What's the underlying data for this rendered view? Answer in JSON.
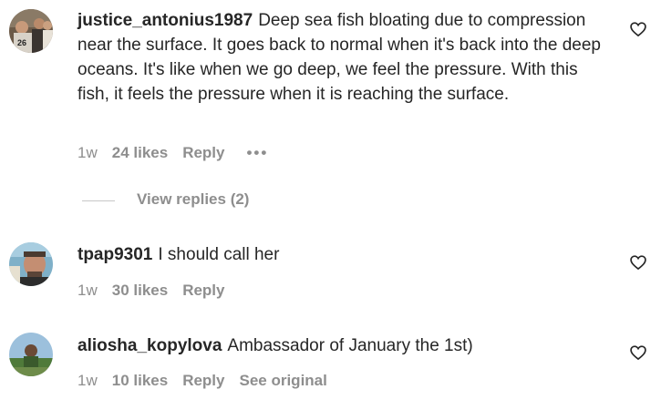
{
  "comments": [
    {
      "username": "justice_antonius1987",
      "text": "Deep sea fish bloating due to compression near the surface. It goes back to normal when it's back into the deep oceans. It's like when we go deep, we feel the pressure. With this fish, it feels the pressure when it is reaching the surface.",
      "time": "1w",
      "likes": "24 likes",
      "reply": "Reply",
      "more": "•••",
      "view_replies": "View replies (2)"
    },
    {
      "username": "tpap9301",
      "text": "I should call her",
      "time": "1w",
      "likes": "30 likes",
      "reply": "Reply"
    },
    {
      "username": "aliosha_kopylova",
      "text": "Ambassador of January the 1st)",
      "time": "1w",
      "likes": "10 likes",
      "reply": "Reply",
      "see_original": "See original"
    }
  ],
  "colors": {
    "primary_text": "#262626",
    "secondary_text": "#8e8e8e",
    "background": "#ffffff"
  },
  "icons": [
    "avatar",
    "heart-icon",
    "more-icon"
  ]
}
